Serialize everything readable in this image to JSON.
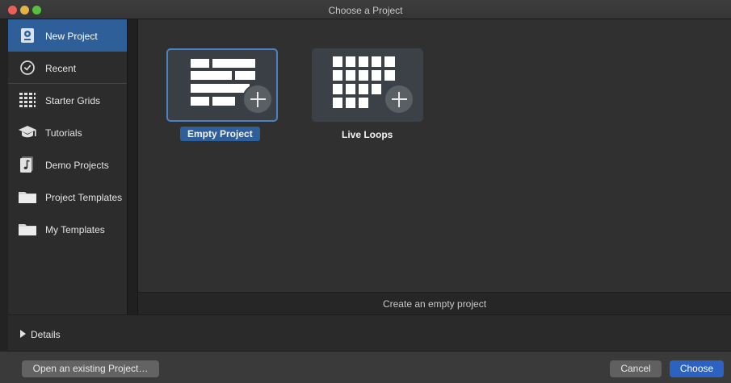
{
  "window": {
    "title": "Choose a Project"
  },
  "sidebar": {
    "items": [
      {
        "label": "New Project",
        "icon": "new-project-icon",
        "selected": true
      },
      {
        "label": "Recent",
        "icon": "clock-icon",
        "selected": false
      },
      {
        "label": "Starter Grids",
        "icon": "grid-icon",
        "selected": false
      },
      {
        "label": "Tutorials",
        "icon": "graduation-cap-icon",
        "selected": false
      },
      {
        "label": "Demo Projects",
        "icon": "music-note-icon",
        "selected": false
      },
      {
        "label": "Project Templates",
        "icon": "folder-icon",
        "selected": false
      },
      {
        "label": "My Templates",
        "icon": "folder-icon",
        "selected": false
      }
    ]
  },
  "main": {
    "tiles": [
      {
        "label": "Empty Project",
        "icon": "empty-project-icon",
        "selected": true
      },
      {
        "label": "Live Loops",
        "icon": "live-loops-icon",
        "selected": false
      }
    ],
    "description": "Create an empty project"
  },
  "details": {
    "label": "Details"
  },
  "footer": {
    "open_existing_label": "Open an existing Project…",
    "cancel_label": "Cancel",
    "choose_label": "Choose"
  },
  "colors": {
    "selection": "#2f5f98",
    "primary_button": "#2e62c2"
  }
}
